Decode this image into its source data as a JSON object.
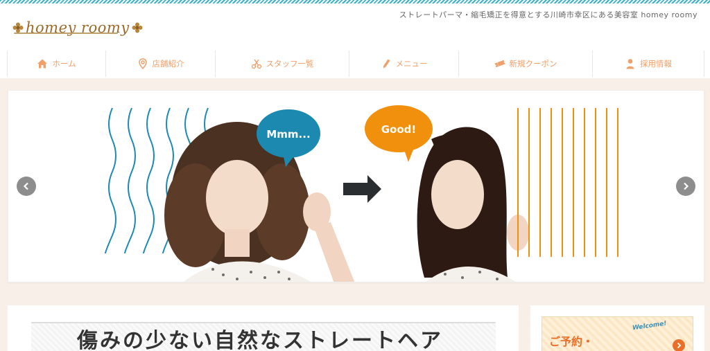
{
  "header": {
    "logo_text": "homey roomy",
    "tagline": "ストレートパーマ・縮毛矯正を得意とする川崎市幸区にある美容室 homey roomy"
  },
  "nav": {
    "items": [
      {
        "label": "ホーム",
        "icon": "home-icon"
      },
      {
        "label": "店舗紹介",
        "icon": "map-pin-icon"
      },
      {
        "label": "スタッフ一覧",
        "icon": "scissors-icon"
      },
      {
        "label": "メニュー",
        "icon": "pencil-icon"
      },
      {
        "label": "新規クーポン",
        "icon": "ticket-icon"
      },
      {
        "label": "採用情報",
        "icon": "person-icon"
      }
    ],
    "color": "#f0a06a"
  },
  "hero": {
    "bubble_left": "Mmm...",
    "bubble_right": "Good!",
    "bubble_left_color": "#1c8ab0",
    "bubble_right_color": "#f0900c",
    "wave_color": "#1c8ab0",
    "line_color": "#f0900c"
  },
  "main": {
    "headline": "傷みの少ない自然なストレートヘア"
  },
  "sidebar": {
    "banner_text": "ご予約・",
    "banner_welcome": "Welcome!"
  }
}
